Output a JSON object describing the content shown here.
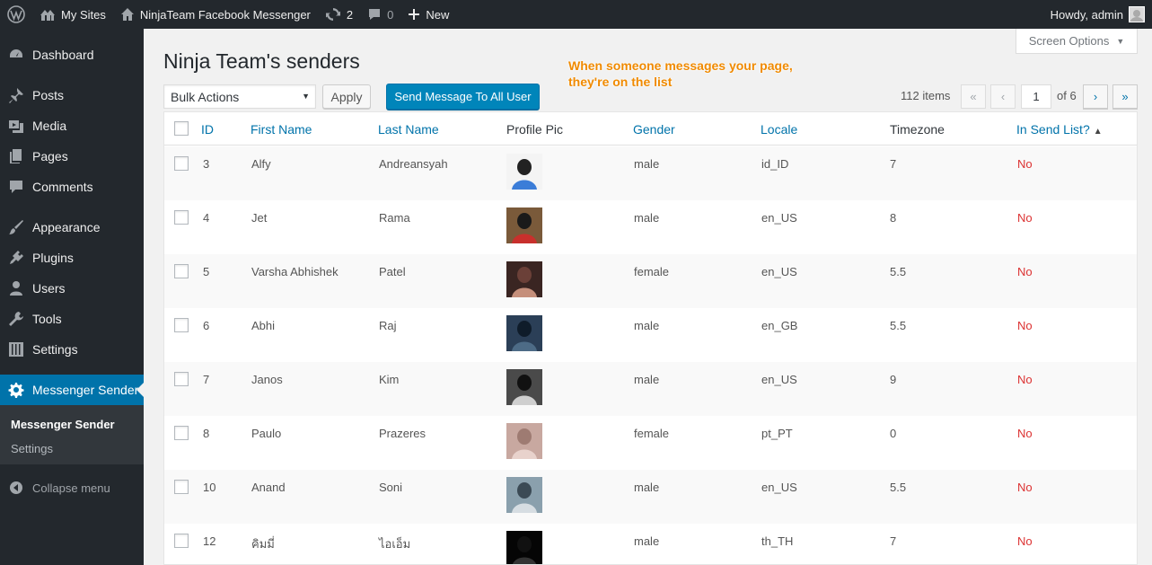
{
  "adminbar": {
    "my_sites": "My Sites",
    "site_name": "NinjaTeam Facebook Messenger",
    "updates_count": "2",
    "comments_count": "0",
    "new_label": "New",
    "howdy": "Howdy, admin"
  },
  "sidebar": {
    "items": [
      {
        "label": "Dashboard",
        "icon": "dashboard-icon"
      },
      {
        "label": "Posts",
        "icon": "pin-icon"
      },
      {
        "label": "Media",
        "icon": "media-icon"
      },
      {
        "label": "Pages",
        "icon": "pages-icon"
      },
      {
        "label": "Comments",
        "icon": "comment-icon"
      },
      {
        "label": "Appearance",
        "icon": "brush-icon"
      },
      {
        "label": "Plugins",
        "icon": "plugin-icon"
      },
      {
        "label": "Users",
        "icon": "user-icon"
      },
      {
        "label": "Tools",
        "icon": "wrench-icon"
      },
      {
        "label": "Settings",
        "icon": "sliders-icon"
      },
      {
        "label": "Messenger Sender",
        "icon": "gear-icon"
      }
    ],
    "submenu": [
      "Messenger Sender",
      "Settings"
    ],
    "collapse": "Collapse menu"
  },
  "screen_options": "Screen Options",
  "page_title": "Ninja Team's senders",
  "annotation": {
    "line1": "When someone messages your page,",
    "line2": "they're on the list"
  },
  "toolbar": {
    "bulk_actions": "Bulk Actions",
    "apply": "Apply",
    "send_all": "Send Message To All User"
  },
  "pagination": {
    "items": "112 items",
    "first": "«",
    "prev": "‹",
    "current_page": "1",
    "of_pages": "of 6",
    "next": "›",
    "last": "»"
  },
  "table": {
    "columns": [
      "ID",
      "First Name",
      "Last Name",
      "Profile Pic",
      "Gender",
      "Locale",
      "Timezone",
      "In Send List?"
    ],
    "rows": [
      {
        "id": "3",
        "first": "Alfy",
        "last": "Andreansyah",
        "gender": "male",
        "locale": "id_ID",
        "timezone": "7",
        "in_send": "No"
      },
      {
        "id": "4",
        "first": "Jet",
        "last": "Rama",
        "gender": "male",
        "locale": "en_US",
        "timezone": "8",
        "in_send": "No"
      },
      {
        "id": "5",
        "first": "Varsha Abhishek",
        "last": "Patel",
        "gender": "female",
        "locale": "en_US",
        "timezone": "5.5",
        "in_send": "No"
      },
      {
        "id": "6",
        "first": "Abhi",
        "last": "Raj",
        "gender": "male",
        "locale": "en_GB",
        "timezone": "5.5",
        "in_send": "No"
      },
      {
        "id": "7",
        "first": "Janos",
        "last": "Kim",
        "gender": "male",
        "locale": "en_US",
        "timezone": "9",
        "in_send": "No"
      },
      {
        "id": "8",
        "first": "Paulo",
        "last": "Prazeres",
        "gender": "female",
        "locale": "pt_PT",
        "timezone": "0",
        "in_send": "No"
      },
      {
        "id": "10",
        "first": "Anand",
        "last": "Soni",
        "gender": "male",
        "locale": "en_US",
        "timezone": "5.5",
        "in_send": "No"
      },
      {
        "id": "12",
        "first": "คิมมี่",
        "last": "ไอเอ็ม",
        "gender": "male",
        "locale": "th_TH",
        "timezone": "7",
        "in_send": "No"
      }
    ]
  },
  "colors": {
    "accent": "#0073aa",
    "button_primary": "#0085ba",
    "sidebar": "#23282d",
    "no_status": "#dc3232",
    "annotation": "#f08a00"
  }
}
